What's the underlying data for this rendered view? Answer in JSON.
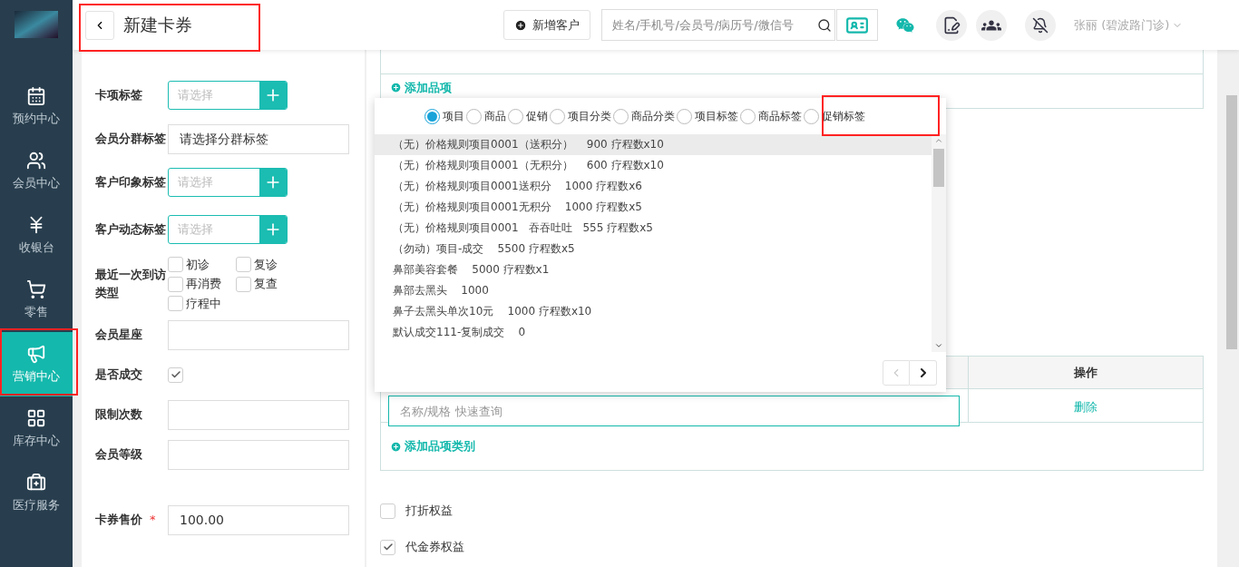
{
  "sidebar": {
    "items": [
      {
        "label": "预约中心",
        "selected": false
      },
      {
        "label": "会员中心",
        "selected": false
      },
      {
        "label": "收银台",
        "selected": false
      },
      {
        "label": "零售",
        "selected": false
      },
      {
        "label": "营销中心",
        "selected": true
      },
      {
        "label": "库存中心",
        "selected": false
      },
      {
        "label": "医疗服务",
        "selected": false
      }
    ]
  },
  "header": {
    "title": "新建卡券",
    "add_customer_button": "新增客户",
    "search": {
      "placeholder": "姓名/手机号/会员号/病历号/微信号"
    },
    "user": "张丽 (碧波路门诊)"
  },
  "form": {
    "fields": [
      {
        "kind": "tag-select",
        "label": "卡项标签",
        "placeholder": "请选择"
      },
      {
        "kind": "text",
        "label": "会员分群标签",
        "value": "请选择分群标签"
      },
      {
        "kind": "tag-select",
        "label": "客户印象标签",
        "placeholder": "请选择"
      },
      {
        "kind": "tag-select",
        "label": "客户动态标签",
        "placeholder": "请选择"
      },
      {
        "kind": "checkbox-group",
        "label": "最近一次到访类型",
        "options": [
          {
            "label": "初诊",
            "checked": false
          },
          {
            "label": "复诊",
            "checked": false
          },
          {
            "label": "再消费",
            "checked": false
          },
          {
            "label": "复查",
            "checked": false
          },
          {
            "label": "疗程中",
            "checked": false
          }
        ]
      },
      {
        "kind": "text",
        "label": "会员星座"
      },
      {
        "kind": "checkbox",
        "label": "是否成交",
        "checked": true
      },
      {
        "kind": "text",
        "label": "限制次数"
      },
      {
        "kind": "text",
        "label": "会员等级"
      },
      {
        "kind": "text",
        "label": "卡券售价",
        "required_mark": "*",
        "value": "100.00"
      }
    ]
  },
  "item_picker": {
    "add_item_link": "添加品项",
    "types": [
      {
        "label": "项目",
        "selected": true
      },
      {
        "label": "商品",
        "selected": false
      },
      {
        "label": "促销",
        "selected": false
      },
      {
        "label": "项目分类",
        "selected": false
      },
      {
        "label": "商品分类",
        "selected": false
      },
      {
        "label": "项目标签",
        "selected": false
      },
      {
        "label": "商品标签",
        "selected": false
      },
      {
        "label": "促销标签",
        "selected": false
      }
    ],
    "options": [
      {
        "text": "（无）价格规则项目0001（送积分）    900 疗程数x10",
        "selected": true
      },
      {
        "text": "（无）价格规则项目0001（无积分）    600 疗程数x10",
        "selected": false
      },
      {
        "text": "（无）价格规则项目0001送积分    1000 疗程数x6",
        "selected": false
      },
      {
        "text": "（无）价格规则项目0001无积分    1000 疗程数x5",
        "selected": false
      },
      {
        "text": "（无）价格规则项目0001   吞吞吐吐   555 疗程数x5",
        "selected": false
      },
      {
        "text": "（勿动）项目-成交    5500 疗程数x5",
        "selected": false
      },
      {
        "text": "鼻部美容套餐    5000 疗程数x1",
        "selected": false
      },
      {
        "text": "鼻部去黑头    1000",
        "selected": false
      },
      {
        "text": "鼻子去黑头单次10元    1000 疗程数x10",
        "selected": false
      },
      {
        "text": "默认成交111-复制成交    0",
        "selected": false
      }
    ],
    "prev_disabled": true,
    "next_disabled": false
  },
  "category_table": {
    "columns": [
      "操作"
    ],
    "search_placeholder": "名称/规格 快速查询",
    "delete_link": "删除",
    "add_link": "添加品项类别"
  },
  "benefits": [
    {
      "label": "打折权益",
      "checked": false
    },
    {
      "label": "代金券权益",
      "checked": true
    }
  ]
}
